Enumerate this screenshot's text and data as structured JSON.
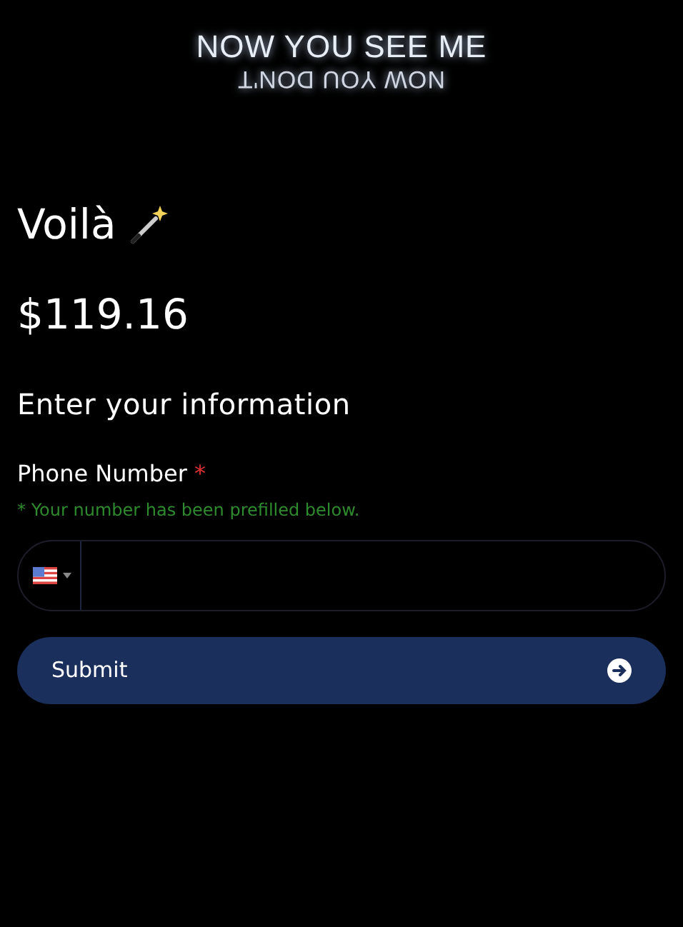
{
  "logo": {
    "line_1": "NOW YOU SEE ME",
    "line_2": "NOW YOU DON'T"
  },
  "heading": "Voilà",
  "price": "$119.16",
  "section_title": "Enter your information",
  "phone_field": {
    "label": "Phone Number",
    "required_mark": "*",
    "hint": "* Your number has been prefilled below."
  },
  "submit_button": {
    "label": "Submit"
  }
}
